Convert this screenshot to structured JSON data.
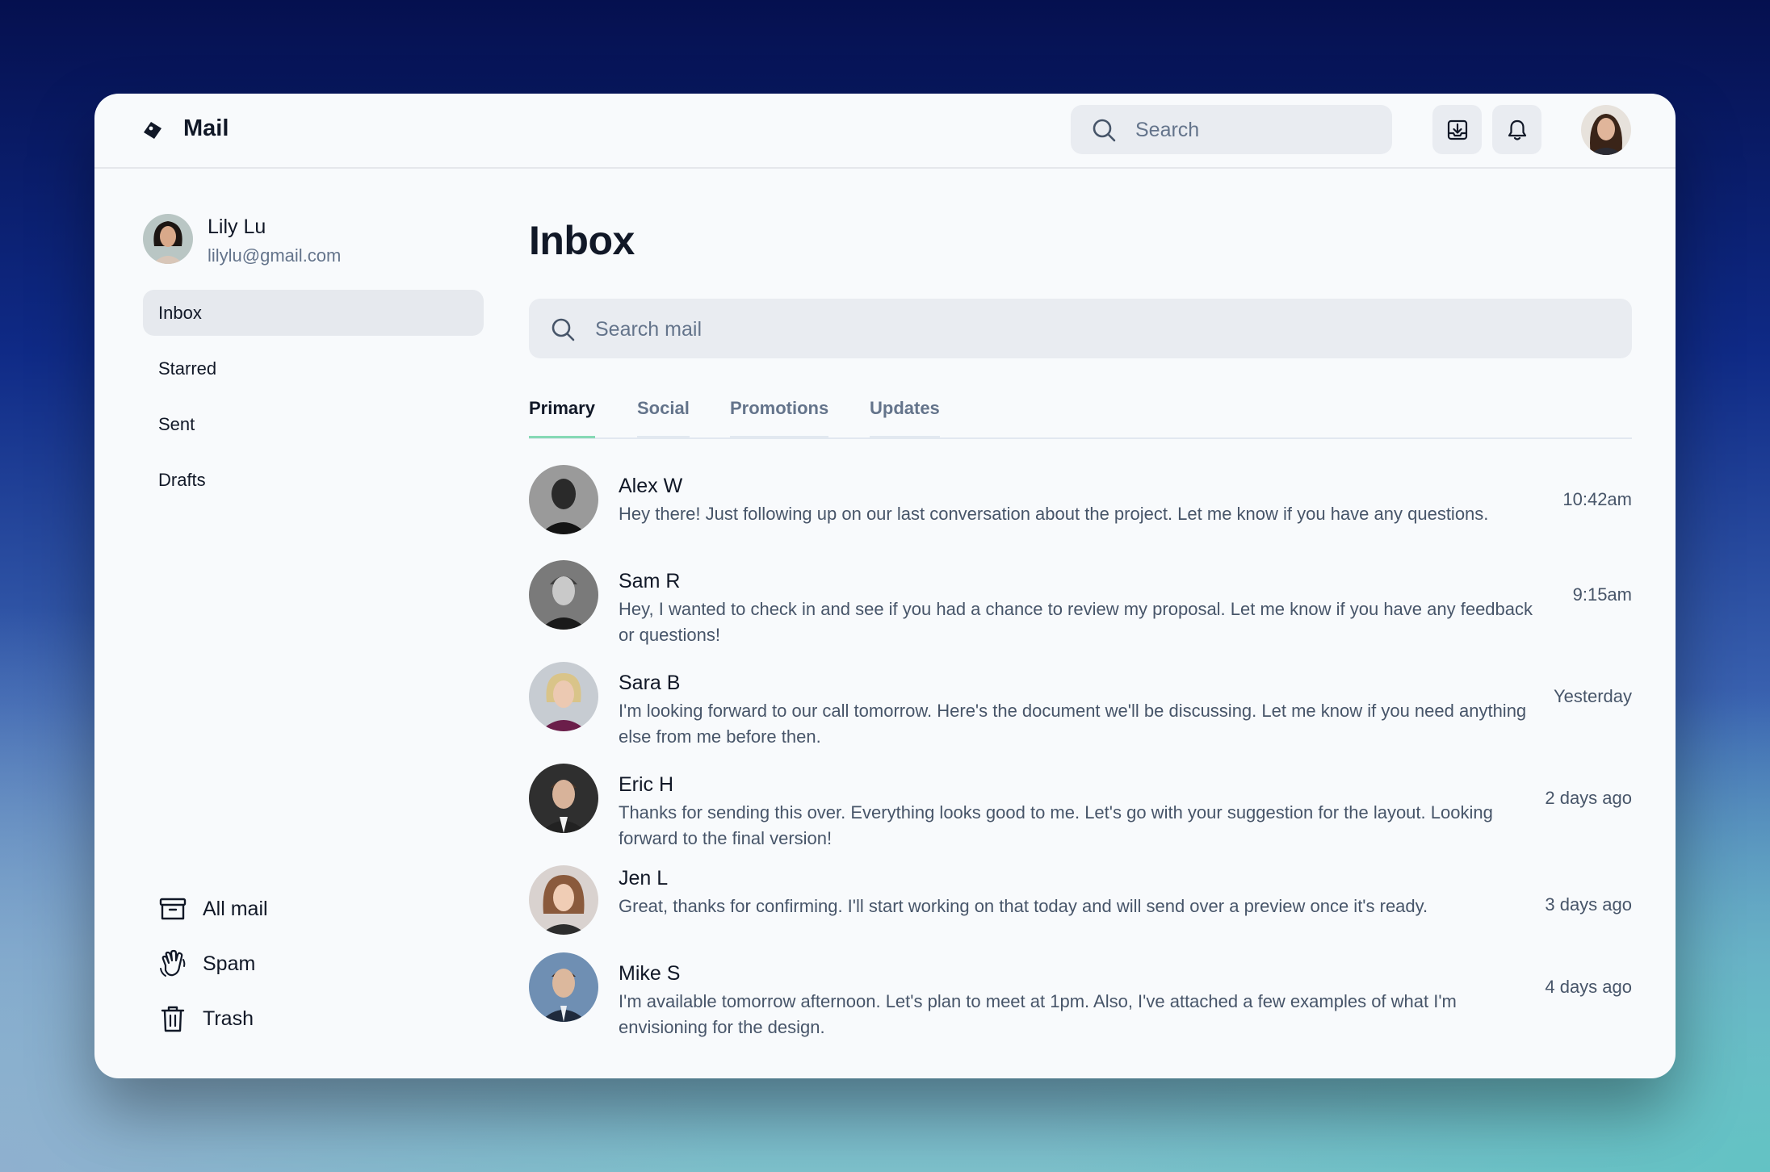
{
  "app": {
    "title": "Mail"
  },
  "header": {
    "search_placeholder": "Search"
  },
  "user": {
    "name": "Lily Lu",
    "email": "lilylu@gmail.com"
  },
  "sidebar": {
    "items": [
      {
        "label": "Inbox",
        "active": true
      },
      {
        "label": "Starred",
        "active": false
      },
      {
        "label": "Sent",
        "active": false
      },
      {
        "label": "Drafts",
        "active": false
      }
    ],
    "bottom_items": [
      {
        "label": "All mail",
        "icon": "archive-icon"
      },
      {
        "label": "Spam",
        "icon": "hand-icon"
      },
      {
        "label": "Trash",
        "icon": "trash-icon"
      }
    ]
  },
  "main": {
    "title": "Inbox",
    "search_placeholder": "Search mail",
    "tabs": [
      {
        "label": "Primary",
        "active": true
      },
      {
        "label": "Social",
        "active": false
      },
      {
        "label": "Promotions",
        "active": false
      },
      {
        "label": "Updates",
        "active": false
      }
    ],
    "emails": [
      {
        "sender": "Alex W",
        "snippet": "Hey there! Just following up on our last conversation about the project. Let me know if you have any questions.",
        "time": "10:42am"
      },
      {
        "sender": "Sam R",
        "snippet": "Hey, I wanted to check in and see if you had a chance to review my proposal. Let me know if you have any feedback or questions!",
        "time": "9:15am"
      },
      {
        "sender": "Sara B",
        "snippet": "I'm looking forward to our call tomorrow. Here's the document we'll be discussing. Let me know if you need anything else from me before then.",
        "time": "Yesterday"
      },
      {
        "sender": "Eric H",
        "snippet": "Thanks for sending this over. Everything looks good to me. Let's go with your suggestion for the layout. Looking forward to the final version!",
        "time": "2 days ago"
      },
      {
        "sender": "Jen L",
        "snippet": "Great, thanks for confirming. I'll start working on that today and will send over a preview once it's ready.",
        "time": "3 days ago"
      },
      {
        "sender": "Mike S",
        "snippet": "I'm available tomorrow afternoon. Let's plan to meet at 1pm. Also, I've attached a few examples of what I'm envisioning for the design.",
        "time": "4 days ago"
      }
    ]
  },
  "colors": {
    "accent_tab_underline": "#86d9b5",
    "active_nav_bg": "#e6e9ee",
    "window_bg": "#f8fafc"
  }
}
